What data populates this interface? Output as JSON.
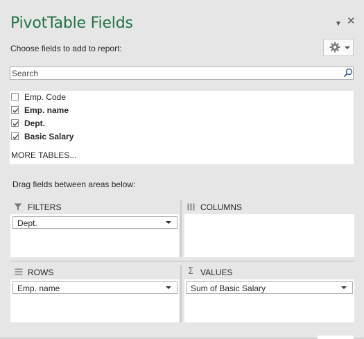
{
  "panel": {
    "title": "PivotTable Fields",
    "subtitle": "Choose fields to add to report:"
  },
  "search": {
    "placeholder": "Search"
  },
  "fields": [
    {
      "label": "Emp. Code",
      "checked": false
    },
    {
      "label": "Emp. name",
      "checked": true
    },
    {
      "label": "Dept.",
      "checked": true
    },
    {
      "label": "Basic Salary",
      "checked": true
    }
  ],
  "more_tables": "MORE TABLES...",
  "areas": {
    "instruction": "Drag fields between areas below:",
    "filters": {
      "title": "FILTERS",
      "items": [
        "Dept."
      ]
    },
    "columns": {
      "title": "COLUMNS",
      "items": []
    },
    "rows": {
      "title": "ROWS",
      "items": [
        "Emp. name"
      ]
    },
    "values": {
      "title": "VALUES",
      "items": [
        "Sum of Basic Salary"
      ]
    }
  },
  "icons": {
    "menu": "dropdown-arrow-icon",
    "close": "close-icon",
    "tools": "gear-icon",
    "search": "search-icon",
    "filters": "filter-funnel-icon",
    "columns": "columns-icon",
    "rows": "rows-icon",
    "values": "sigma-icon"
  },
  "colors": {
    "title": "#217346",
    "background": "#e6e6e6"
  }
}
